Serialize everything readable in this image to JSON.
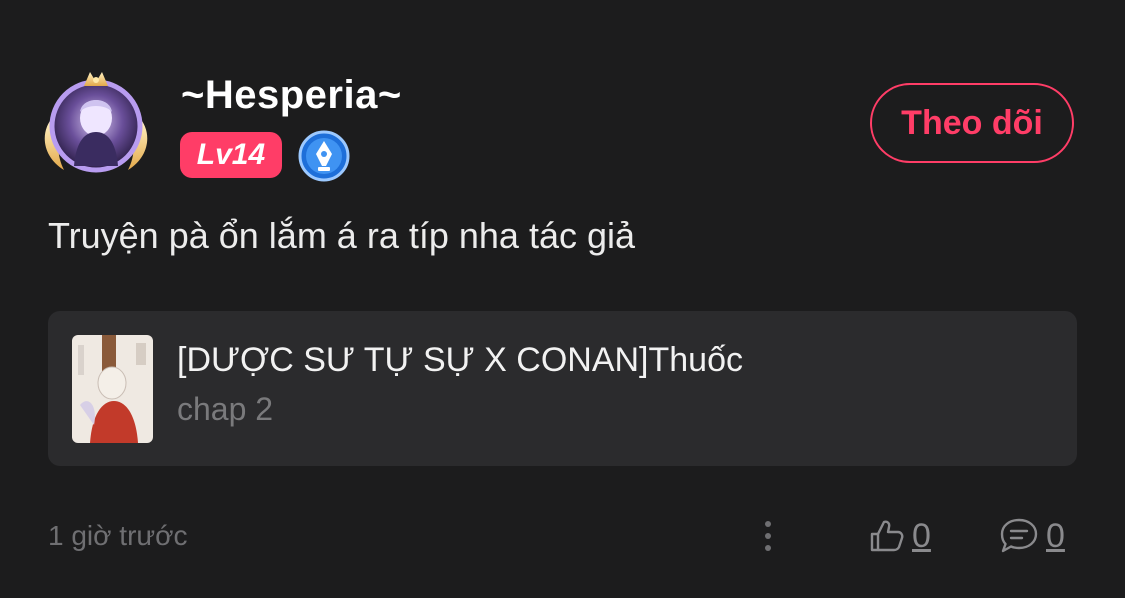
{
  "comment": {
    "user": {
      "name": "~Hesperia~",
      "level": "Lv14",
      "avatar_icon": "anime-avatar-with-golden-frame",
      "writer_badge_icon": "pen-nib-badge-icon"
    },
    "follow_label": "Theo dõi",
    "text": "Truyện pà ổn lắm á ra típ nha tác giả",
    "story": {
      "title": "[DƯỢC SƯ TỰ SỰ X CONAN]Thuốc",
      "chapter": "chap 2",
      "cover_icon": "story-cover-thumbnail"
    },
    "timestamp": "1 giờ trước",
    "likes": "0",
    "replies": "0"
  },
  "colors": {
    "background": "#1c1c1d",
    "accent": "#ff3d67",
    "card": "#2b2b2d",
    "muted": "#6f6f72"
  }
}
